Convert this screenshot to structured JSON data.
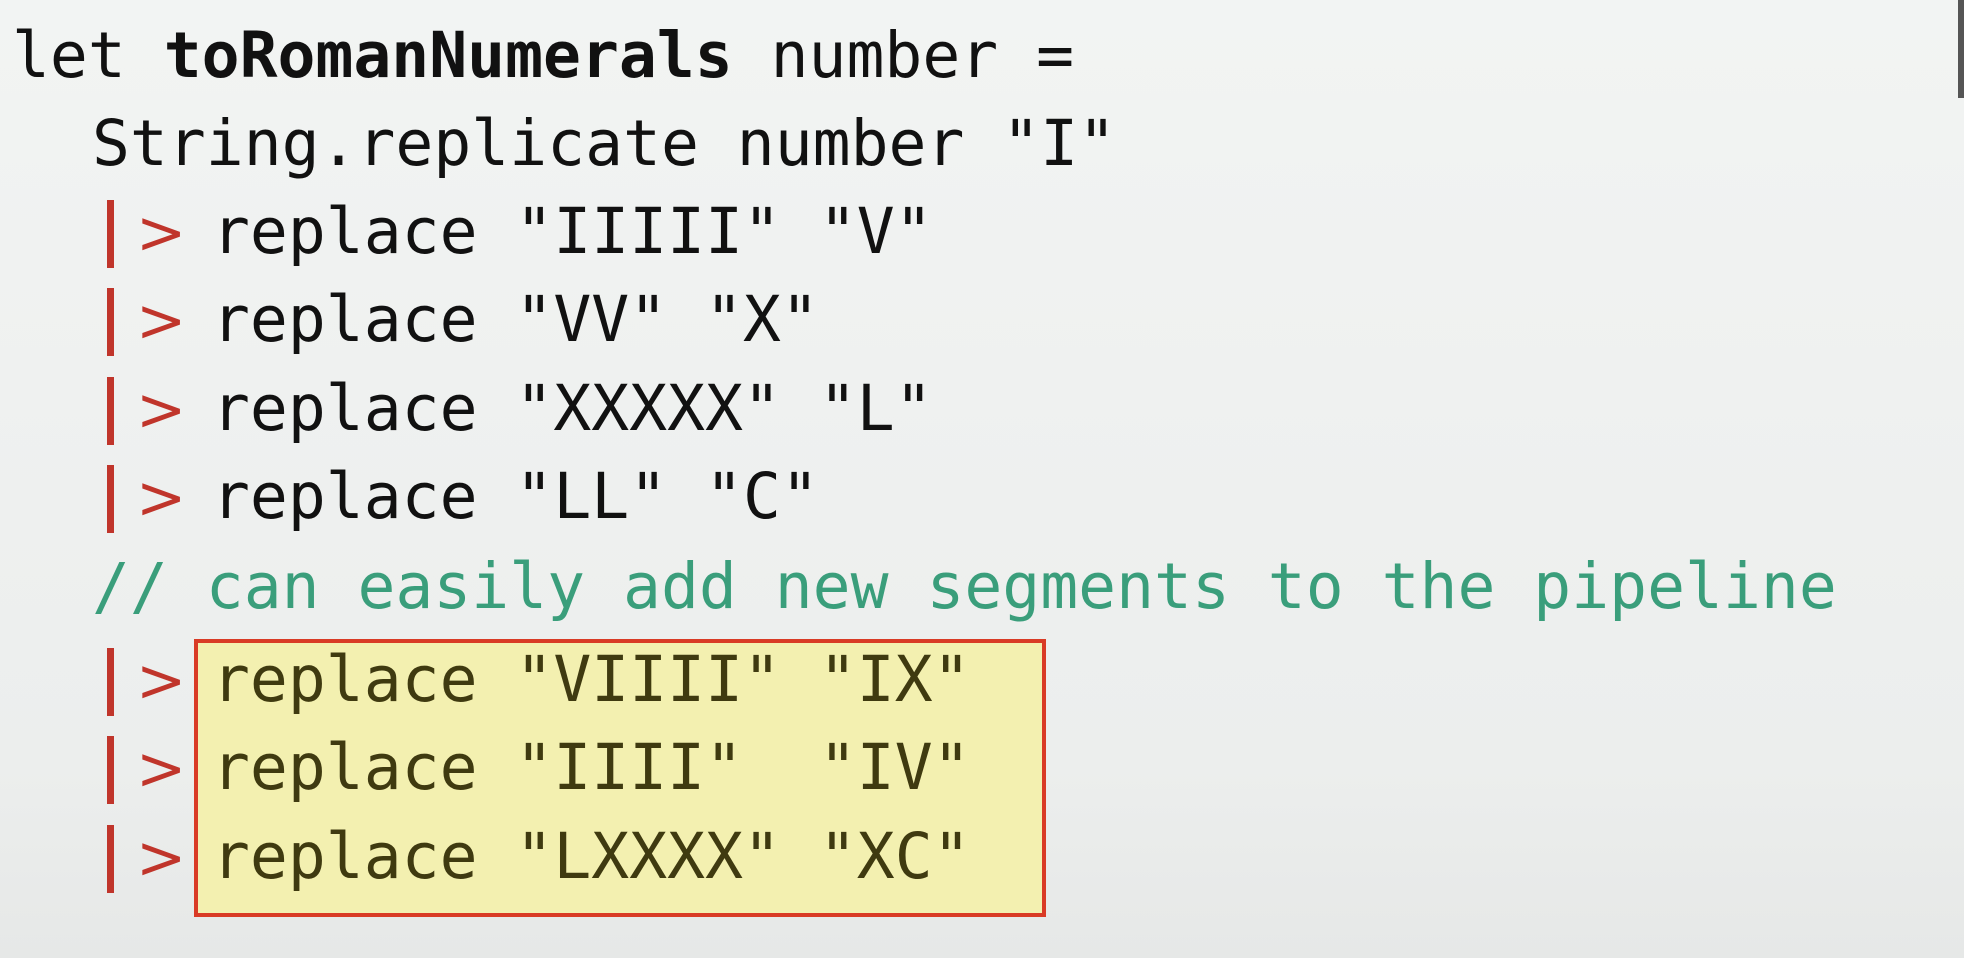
{
  "code": {
    "line1": {
      "keyword": "let ",
      "name": "toRomanNumerals",
      "rest": " number ="
    },
    "line2": "String.replicate number \"I\"",
    "pipe_symbol": ">",
    "pipeline": [
      "replace \"IIIII\" \"V\"",
      "replace \"VV\" \"X\"",
      "replace \"XXXXX\" \"L\"",
      "replace \"LL\" \"C\""
    ],
    "comment": "// can easily add new segments to the pipeline",
    "highlighted": [
      "replace \"VIIII\" \"IX\"",
      "replace \"IIII\"  \"IV\"",
      "replace \"LXXXX\" \"XC\""
    ]
  },
  "colors": {
    "pipe": "#c0352b",
    "comment": "#3a9e7b",
    "highlight_bg": "#f3f0b0",
    "highlight_border": "#d93b25"
  }
}
